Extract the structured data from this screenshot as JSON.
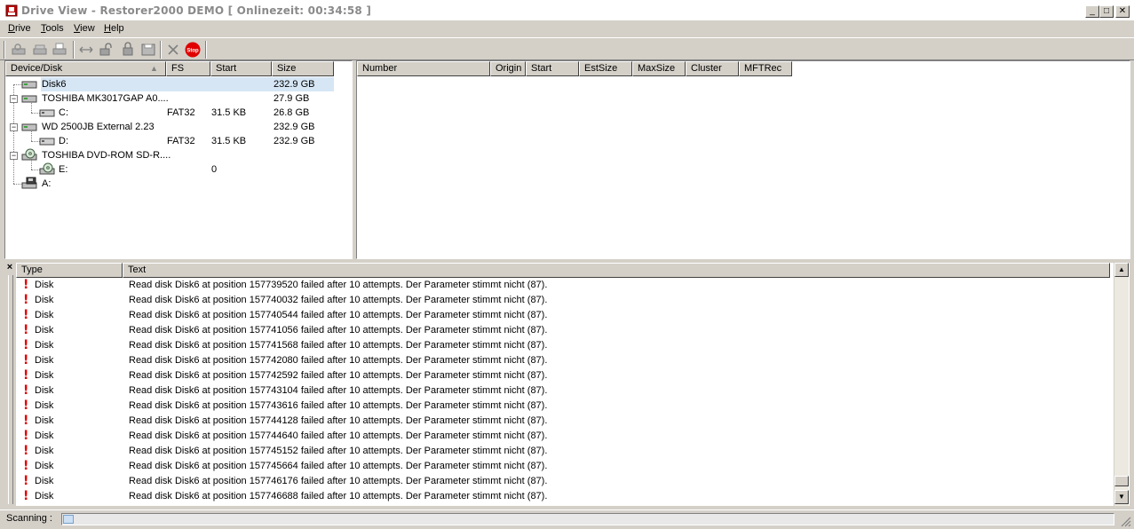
{
  "window": {
    "title": "Drive View - Restorer2000 DEMO [ Onlinezeit: 00:34:58 ]",
    "minimize": "_",
    "maximize": "□",
    "close": "✕"
  },
  "menu": [
    {
      "label": "Drive"
    },
    {
      "label": "Tools"
    },
    {
      "label": "View"
    },
    {
      "label": "Help"
    }
  ],
  "toolbar": {
    "icons": [
      "scan-icon",
      "scan-all-icon",
      "print-icon",
      "compare-icon",
      "lock-icon",
      "unlock-icon",
      "save-icon",
      "delete-icon",
      "stop-icon"
    ],
    "stop_label": "Stop"
  },
  "disk_pane": {
    "headers": [
      "Device/Disk",
      "FS",
      "Start",
      "Size"
    ],
    "rows": [
      {
        "name": "Disk6",
        "fs": "",
        "start": "",
        "size": "232.9 GB",
        "selected": true
      },
      {
        "name": "TOSHIBA MK3017GAP A0....",
        "fs": "",
        "start": "",
        "size": "27.9 GB"
      },
      {
        "name": "C:",
        "fs": "FAT32",
        "start": "31.5 KB",
        "size": "26.8 GB"
      },
      {
        "name": "WD 2500JB External 2.23",
        "fs": "",
        "start": "",
        "size": "232.9 GB"
      },
      {
        "name": "D:",
        "fs": "FAT32",
        "start": "31.5 KB",
        "size": "232.9 GB"
      },
      {
        "name": "TOSHIBA DVD-ROM SD-R....",
        "fs": "",
        "start": "",
        "size": ""
      },
      {
        "name": "E:",
        "fs": "",
        "start": "0",
        "size": ""
      },
      {
        "name": "A:",
        "fs": "",
        "start": "",
        "size": ""
      }
    ]
  },
  "file_pane": {
    "headers": [
      "Number",
      "Origin",
      "Start",
      "EstSize",
      "MaxSize",
      "Cluster",
      "MFTRec"
    ]
  },
  "log_pane": {
    "close": "×",
    "headers": [
      "Type",
      "Text"
    ],
    "rows": [
      {
        "type": "Disk",
        "text": "Read disk Disk6 at position 157739520 failed after 10 attempts. Der Parameter stimmt nicht (87)."
      },
      {
        "type": "Disk",
        "text": "Read disk Disk6 at position 157740032 failed after 10 attempts. Der Parameter stimmt nicht (87)."
      },
      {
        "type": "Disk",
        "text": "Read disk Disk6 at position 157740544 failed after 10 attempts. Der Parameter stimmt nicht (87)."
      },
      {
        "type": "Disk",
        "text": "Read disk Disk6 at position 157741056 failed after 10 attempts. Der Parameter stimmt nicht (87)."
      },
      {
        "type": "Disk",
        "text": "Read disk Disk6 at position 157741568 failed after 10 attempts. Der Parameter stimmt nicht (87)."
      },
      {
        "type": "Disk",
        "text": "Read disk Disk6 at position 157742080 failed after 10 attempts. Der Parameter stimmt nicht (87)."
      },
      {
        "type": "Disk",
        "text": "Read disk Disk6 at position 157742592 failed after 10 attempts. Der Parameter stimmt nicht (87)."
      },
      {
        "type": "Disk",
        "text": "Read disk Disk6 at position 157743104 failed after 10 attempts. Der Parameter stimmt nicht (87)."
      },
      {
        "type": "Disk",
        "text": "Read disk Disk6 at position 157743616 failed after 10 attempts. Der Parameter stimmt nicht (87)."
      },
      {
        "type": "Disk",
        "text": "Read disk Disk6 at position 157744128 failed after 10 attempts. Der Parameter stimmt nicht (87)."
      },
      {
        "type": "Disk",
        "text": "Read disk Disk6 at position 157744640 failed after 10 attempts. Der Parameter stimmt nicht (87)."
      },
      {
        "type": "Disk",
        "text": "Read disk Disk6 at position 157745152 failed after 10 attempts. Der Parameter stimmt nicht (87)."
      },
      {
        "type": "Disk",
        "text": "Read disk Disk6 at position 157745664 failed after 10 attempts. Der Parameter stimmt nicht (87)."
      },
      {
        "type": "Disk",
        "text": "Read disk Disk6 at position 157746176 failed after 10 attempts. Der Parameter stimmt nicht (87)."
      },
      {
        "type": "Disk",
        "text": "Read disk Disk6 at position 157746688 failed after 10 attempts. Der Parameter stimmt nicht (87)."
      }
    ]
  },
  "status": {
    "label": "Scanning :",
    "progress": 0.01
  },
  "colors": {
    "selection": "#d6e6f5",
    "error": "#e00000",
    "face": "#d4d0c8"
  }
}
